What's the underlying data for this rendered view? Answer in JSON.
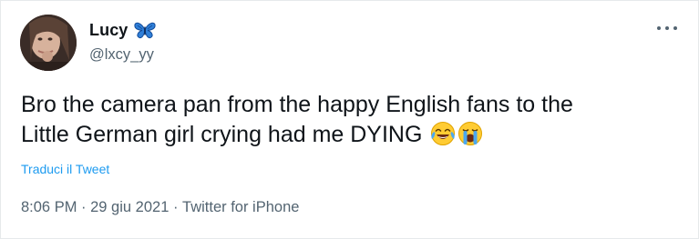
{
  "author": {
    "display_name": "Lucy",
    "handle": "@lxcy_yy",
    "name_badge_icon": "butterfly-icon",
    "avatar_icon": "avatar"
  },
  "more_icon": "more-horizontal-icon",
  "tweet": {
    "text_line_1": "Bro the camera pan from the happy English fans to the",
    "text_line_2": "Little German girl crying had me DYING",
    "emojis": [
      "face-with-tears-of-joy-icon",
      "loudly-crying-face-icon"
    ],
    "translate_label": "Traduci il Tweet"
  },
  "meta": {
    "time": "8:06 PM",
    "separator_1": " · ",
    "date": "29 giu 2021",
    "separator_2": " · ",
    "source": "Twitter for iPhone"
  },
  "colors": {
    "link_blue": "#1d9bf0",
    "secondary_text": "#536471",
    "primary_text": "#0f1419",
    "badge_blue": "#1d6fd1",
    "border": "#e6e9eb"
  }
}
